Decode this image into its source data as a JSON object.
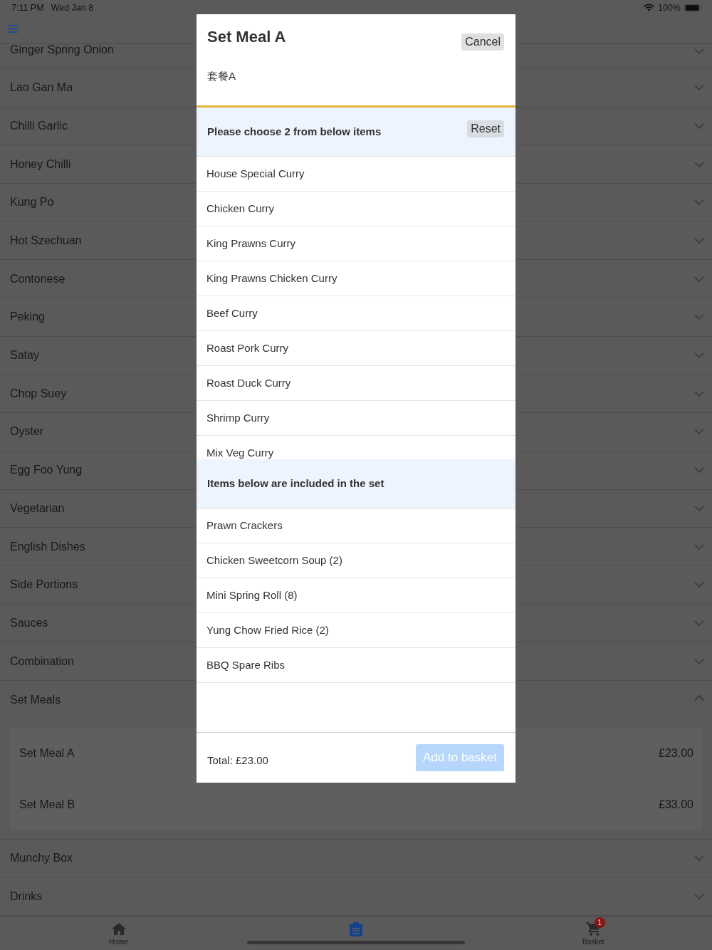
{
  "status_bar": {
    "time": "7:11 PM",
    "date": "Wed Jan 8",
    "battery": "100%"
  },
  "categories": [
    {
      "name": "Ginger Spring Onion",
      "expanded": false
    },
    {
      "name": "Lao Gan Ma",
      "expanded": false
    },
    {
      "name": "Chilli Garlic",
      "expanded": false
    },
    {
      "name": "Honey Chilli",
      "expanded": false
    },
    {
      "name": "Kung Po",
      "expanded": false
    },
    {
      "name": "Hot Szechuan",
      "expanded": false
    },
    {
      "name": "Contonese",
      "expanded": false
    },
    {
      "name": "Peking",
      "expanded": false
    },
    {
      "name": "Satay",
      "expanded": false
    },
    {
      "name": "Chop Suey",
      "expanded": false
    },
    {
      "name": "Oyster",
      "expanded": false
    },
    {
      "name": "Egg Foo Yung",
      "expanded": false
    },
    {
      "name": "Vegetarian",
      "expanded": false
    },
    {
      "name": "English Dishes",
      "expanded": false
    },
    {
      "name": "Side Portions",
      "expanded": false
    },
    {
      "name": "Sauces",
      "expanded": false
    },
    {
      "name": "Combination",
      "expanded": false
    },
    {
      "name": "Set Meals",
      "expanded": true,
      "items": [
        {
          "name": "Set Meal A",
          "price": "£23.00"
        },
        {
          "name": "Set Meal B",
          "price": "£33.00"
        }
      ]
    },
    {
      "name": "Munchy Box",
      "expanded": false
    },
    {
      "name": "Drinks",
      "expanded": false
    }
  ],
  "dialog": {
    "title": "Set Meal A",
    "subtitle": "套餐A",
    "cancel_label": "Cancel",
    "choice": {
      "prompt": "Please choose 2 from below items",
      "reset_label": "Reset",
      "options": [
        {
          "name": "House Special Curry",
          "selected": false
        },
        {
          "name": "Chicken Curry",
          "selected": false
        },
        {
          "name": "King Prawns Curry",
          "selected": false
        },
        {
          "name": "King Prawns Chicken Curry",
          "selected": false
        },
        {
          "name": "Beef Curry",
          "selected": false
        },
        {
          "name": "Roast Pork Curry",
          "selected": false
        },
        {
          "name": "Roast Duck Curry",
          "selected": false
        },
        {
          "name": "Shrimp Curry",
          "selected": false
        },
        {
          "name": "Mix Veg Curry",
          "selected": false
        }
      ]
    },
    "included": {
      "heading": "Items below are included in the set",
      "items": [
        "Prawn Crackers",
        "Chicken Sweetcorn Soup (2)",
        "Mini Spring Roll (8)",
        "Yung Chow Fried Rice (2)",
        "BBQ Spare Ribs"
      ]
    },
    "total": "Total: £23.00",
    "add_button": {
      "label": "Add to basket",
      "disabled": true
    }
  },
  "tab_bar": [
    {
      "label": "Home",
      "selected": false
    },
    {
      "selected": true
    },
    {
      "label": "Basket",
      "selected": false,
      "badge": "1"
    }
  ]
}
